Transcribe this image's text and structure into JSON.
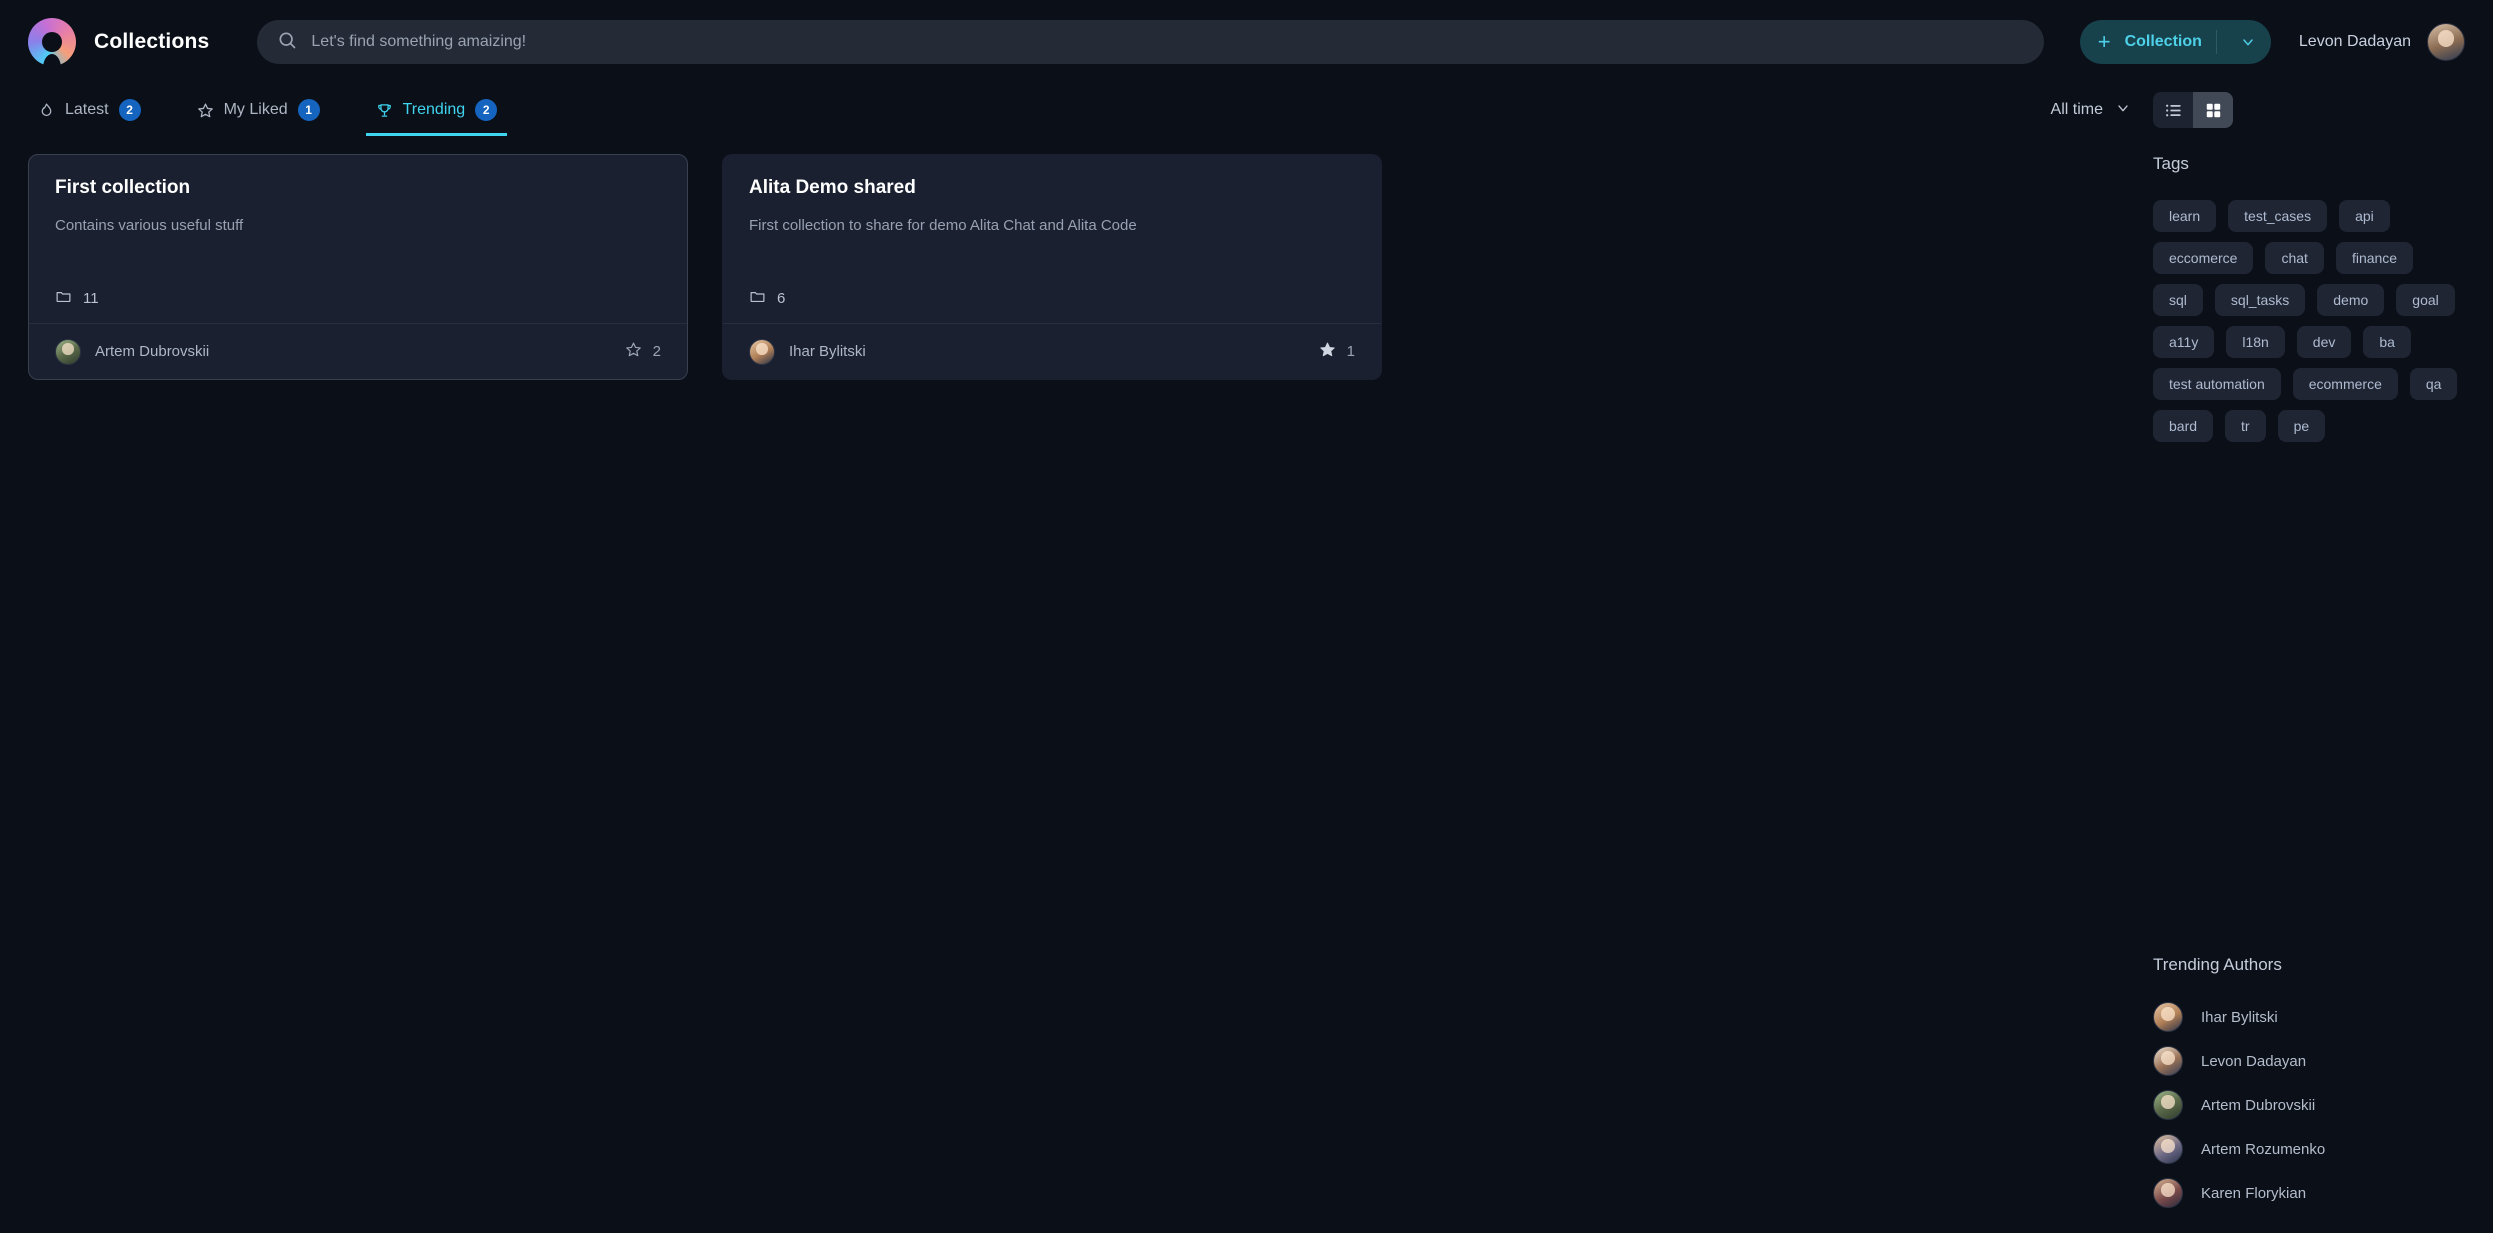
{
  "header": {
    "brand": "Collections",
    "logo_icon": "app-logo-icon",
    "search": {
      "placeholder": "Let's find something amaizing!",
      "value": "",
      "icon": "search-icon"
    },
    "new_collection": {
      "plus": "+",
      "label": "Collection",
      "chevron_icon": "chevron-down-icon"
    },
    "user": {
      "name": "Levon Dadayan",
      "avatar": "user-avatar"
    }
  },
  "tabs": [
    {
      "label": "Latest",
      "badge": "2",
      "icon": "flame-icon",
      "active": false
    },
    {
      "label": "My Liked",
      "badge": "1",
      "icon": "star-icon",
      "active": false
    },
    {
      "label": "Trending",
      "badge": "2",
      "icon": "trophy-icon",
      "active": true
    }
  ],
  "controls": {
    "time_filter": {
      "label": "All time",
      "chevron_icon": "chevron-down-icon"
    },
    "view_list": {
      "icon": "list-view-icon",
      "active": false
    },
    "view_grid": {
      "icon": "grid-view-icon",
      "active": true
    }
  },
  "cards": [
    {
      "title": "First collection",
      "description": "Contains various useful stuff",
      "folder_icon": "folder-icon",
      "count": "11",
      "author": "Artem Dubrovskii",
      "likes": "2",
      "liked": false,
      "like_icon": "star-outline-icon"
    },
    {
      "title": "Alita Demo shared",
      "description": "First collection to share for demo Alita Chat and Alita Code",
      "folder_icon": "folder-icon",
      "count": "6",
      "author": "Ihar Bylitski",
      "likes": "1",
      "liked": true,
      "like_icon": "star-filled-icon"
    }
  ],
  "sidebar": {
    "tags_title": "Tags",
    "tags": [
      "learn",
      "test_cases",
      "api",
      "eccomerce",
      "chat",
      "finance",
      "sql",
      "sql_tasks",
      "demo",
      "goal",
      "a11y",
      "l18n",
      "dev",
      "ba",
      "test automation",
      "ecommerce",
      "qa",
      "bard",
      "tr",
      "pe"
    ],
    "authors_title": "Trending Authors",
    "authors": [
      "Ihar Bylitski",
      "Levon Dadayan",
      "Artem Dubrovskii",
      "Artem Rozumenko",
      "Karen Florykian"
    ]
  },
  "colors": {
    "background": "#0b0f18",
    "card": "#1a2030",
    "accent_cyan": "#3fd4ef",
    "badge_blue": "#1565c0",
    "button_teal_bg": "#17424c"
  }
}
